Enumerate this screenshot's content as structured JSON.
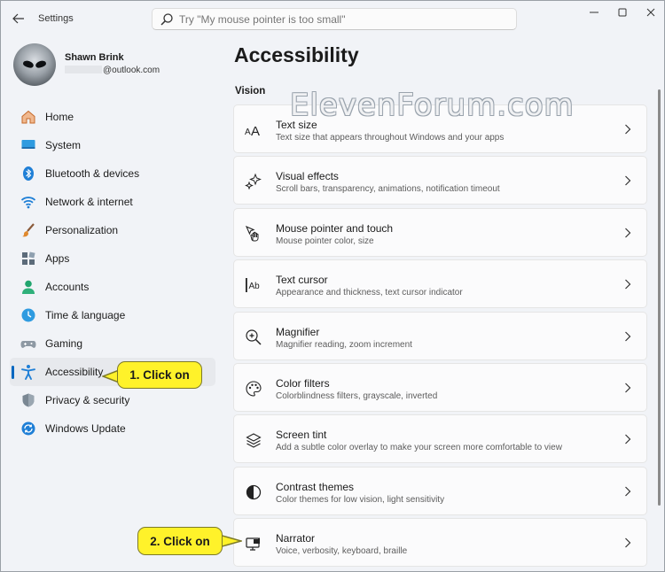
{
  "window": {
    "app_title": "Settings",
    "search_placeholder": "Try \"My mouse pointer is too small\""
  },
  "profile": {
    "name": "Shawn Brink",
    "email": "@outlook.com"
  },
  "sidebar": {
    "items": [
      {
        "label": "Home",
        "icon": "home-icon"
      },
      {
        "label": "System",
        "icon": "system-icon"
      },
      {
        "label": "Bluetooth & devices",
        "icon": "bluetooth-icon"
      },
      {
        "label": "Network & internet",
        "icon": "wifi-icon"
      },
      {
        "label": "Personalization",
        "icon": "brush-icon"
      },
      {
        "label": "Apps",
        "icon": "apps-icon"
      },
      {
        "label": "Accounts",
        "icon": "accounts-icon"
      },
      {
        "label": "Time & language",
        "icon": "clock-globe-icon"
      },
      {
        "label": "Gaming",
        "icon": "gamepad-icon"
      },
      {
        "label": "Accessibility",
        "icon": "accessibility-icon",
        "selected": true
      },
      {
        "label": "Privacy & security",
        "icon": "shield-icon"
      },
      {
        "label": "Windows Update",
        "icon": "windows-update-icon"
      }
    ]
  },
  "main": {
    "page_title": "Accessibility",
    "section_title": "Vision",
    "cards": [
      {
        "title": "Text size",
        "desc": "Text size that appears throughout Windows and your apps",
        "icon": "text-size-icon"
      },
      {
        "title": "Visual effects",
        "desc": "Scroll bars, transparency, animations, notification timeout",
        "icon": "sparkle-icon"
      },
      {
        "title": "Mouse pointer and touch",
        "desc": "Mouse pointer color, size",
        "icon": "pointer-touch-icon"
      },
      {
        "title": "Text cursor",
        "desc": "Appearance and thickness, text cursor indicator",
        "icon": "text-cursor-icon"
      },
      {
        "title": "Magnifier",
        "desc": "Magnifier reading, zoom increment",
        "icon": "magnifier-icon"
      },
      {
        "title": "Color filters",
        "desc": "Colorblindness filters, grayscale, inverted",
        "icon": "palette-icon"
      },
      {
        "title": "Screen tint",
        "desc": "Add a subtle color overlay to make your screen more comfortable to view",
        "icon": "layers-icon"
      },
      {
        "title": "Contrast themes",
        "desc": "Color themes for low vision, light sensitivity",
        "icon": "contrast-icon"
      },
      {
        "title": "Narrator",
        "desc": "Voice, verbosity, keyboard, braille",
        "icon": "narrator-icon"
      }
    ]
  },
  "annotations": {
    "callout_1": "1. Click on",
    "callout_2": "2. Click on",
    "watermark": "ElevenForum.com",
    "color": "#fff22a"
  }
}
